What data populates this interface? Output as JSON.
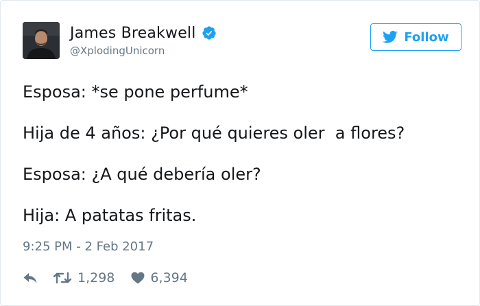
{
  "user": {
    "display_name": "James Breakwell",
    "handle": "@XplodingUnicorn",
    "verified": true
  },
  "follow_button": {
    "label": "Follow",
    "icon": "twitter-bird-icon"
  },
  "tweet": {
    "lines": [
      "Esposa: *se pone perfume*",
      "Hija de 4 años: ¿Por qué quieres oler  a flores?",
      "Esposa: ¿A qué debería oler?",
      "Hija: A patatas fritas."
    ],
    "timestamp": "9:25 PM - 2 Feb 2017"
  },
  "actions": {
    "reply_icon": "reply-icon",
    "retweet_icon": "retweet-icon",
    "retweets": "1,298",
    "like_icon": "heart-icon",
    "likes": "6,394"
  },
  "colors": {
    "accent": "#1da1f2",
    "text": "#14171a",
    "secondary": "#657786",
    "border": "#e1e8ed"
  }
}
